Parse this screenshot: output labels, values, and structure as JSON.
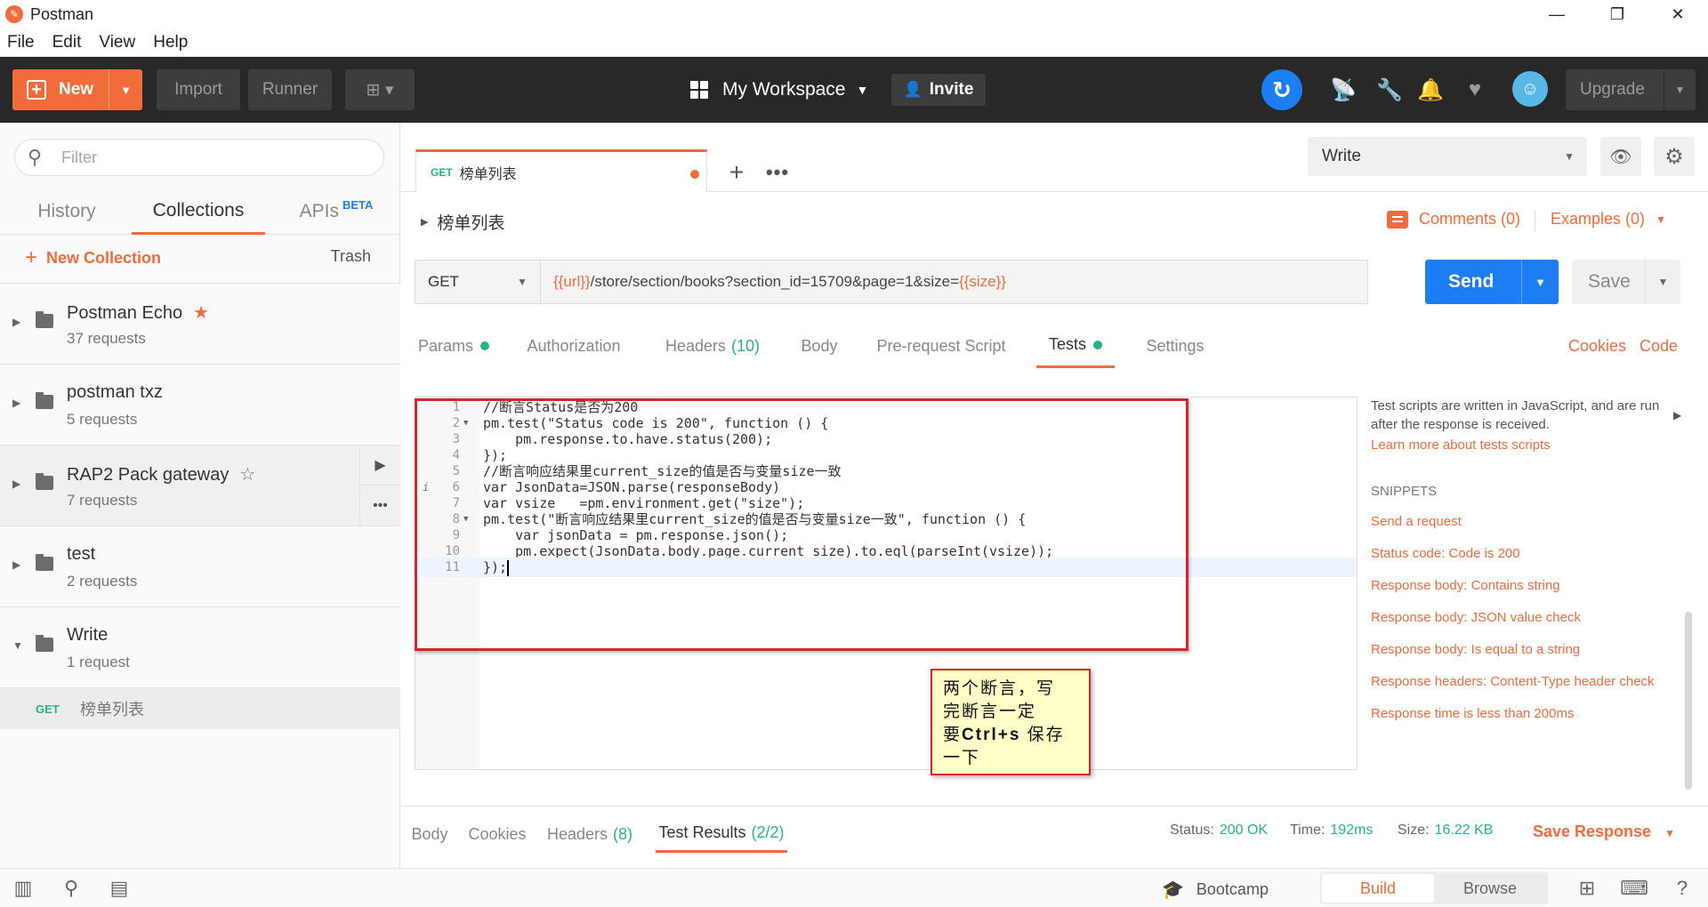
{
  "window": {
    "title": "Postman",
    "controls": [
      "minimize",
      "restore",
      "close"
    ]
  },
  "menu": [
    "File",
    "Edit",
    "View",
    "Help"
  ],
  "header": {
    "new_label": "New",
    "import_label": "Import",
    "runner_label": "Runner",
    "workspace_label": "My Workspace",
    "invite_label": "Invite",
    "upgrade_label": "Upgrade"
  },
  "sidebar": {
    "filter_placeholder": "Filter",
    "tabs": [
      "History",
      "Collections",
      "APIs"
    ],
    "beta_label": "BETA",
    "active_tab": "Collections",
    "new_collection_label": "New Collection",
    "trash_label": "Trash",
    "collections": [
      {
        "name": "Postman Echo",
        "count": "37 requests",
        "starred": true
      },
      {
        "name": "postman txz",
        "count": "5 requests",
        "starred": false
      },
      {
        "name": "RAP2 Pack gateway",
        "count": "7 requests",
        "starred": false
      },
      {
        "name": "test",
        "count": "2 requests",
        "starred": false
      },
      {
        "name": "Write",
        "count": "1 request",
        "starred": false,
        "expanded": true
      }
    ],
    "request": {
      "method": "GET",
      "name": "榜单列表"
    }
  },
  "main": {
    "tab": {
      "method": "GET",
      "title": "榜单列表"
    },
    "environment": "Write",
    "breadcrumb": "榜单列表",
    "comments_label": "Comments (0)",
    "examples_label": "Examples (0)",
    "method": "GET",
    "url": {
      "var1": "{{url}}",
      "path": "/store/section/books?section_id=15709&page=1&size=",
      "var2": "{{size}}"
    },
    "send_label": "Send",
    "save_label": "Save",
    "request_tabs": {
      "params": "Params",
      "authorization": "Authorization",
      "headers": "Headers",
      "headers_count": "(10)",
      "body": "Body",
      "prerequest": "Pre-request Script",
      "tests": "Tests",
      "settings": "Settings",
      "cookies": "Cookies",
      "code": "Code"
    },
    "code_lines": [
      "//断言Status是否为200",
      "pm.test(\"Status code is 200\", function () {",
      "    pm.response.to.have.status(200);",
      "});",
      "//断言响应结果里current_size的值是否与变量size一致",
      "var JsonData=JSON.parse(responseBody)",
      "var vsize   =pm.environment.get(\"size\");",
      "pm.test(\"断言响应结果里current_size的值是否与变量size一致\", function () {",
      "    var jsonData = pm.response.json();",
      "    pm.expect(JsonData.body.page.current_size).to.eql(parseInt(vsize));",
      "});"
    ],
    "note": {
      "line1": "两个断言，写",
      "line2": "完断言一定",
      "line3_a": "要",
      "line3_b": "Ctrl+s",
      "line3_c": " 保存",
      "line4": "一下"
    },
    "snippets": {
      "description": "Test scripts are written in JavaScript, and are run after the response is received.",
      "learn_more": "Learn more about tests scripts",
      "title": "SNIPPETS",
      "items": [
        "Send a request",
        "Status code: Code is 200",
        "Response body: Contains string",
        "Response body: JSON value check",
        "Response body: Is equal to a string",
        "Response headers: Content-Type header check",
        "Response time is less than 200ms"
      ]
    },
    "response_tabs": {
      "body": "Body",
      "cookies": "Cookies",
      "headers": "Headers",
      "headers_count": "(8)",
      "test_results": "Test Results",
      "test_results_count": "(2/2)"
    },
    "status": {
      "status_label": "Status:",
      "status_value": "200 OK",
      "time_label": "Time:",
      "time_value": "192ms",
      "size_label": "Size:",
      "size_value": "16.22 KB"
    },
    "save_response_label": "Save Response"
  },
  "statusbar": {
    "bootcamp_label": "Bootcamp",
    "build_label": "Build",
    "browse_label": "Browse",
    "active_mode": "Build"
  },
  "colors": {
    "accent": "#f26b3a",
    "send_blue": "#1c7ef2",
    "success_green": "#26b47f",
    "header_bg": "#282828",
    "annotation_red": "#d8232a"
  }
}
